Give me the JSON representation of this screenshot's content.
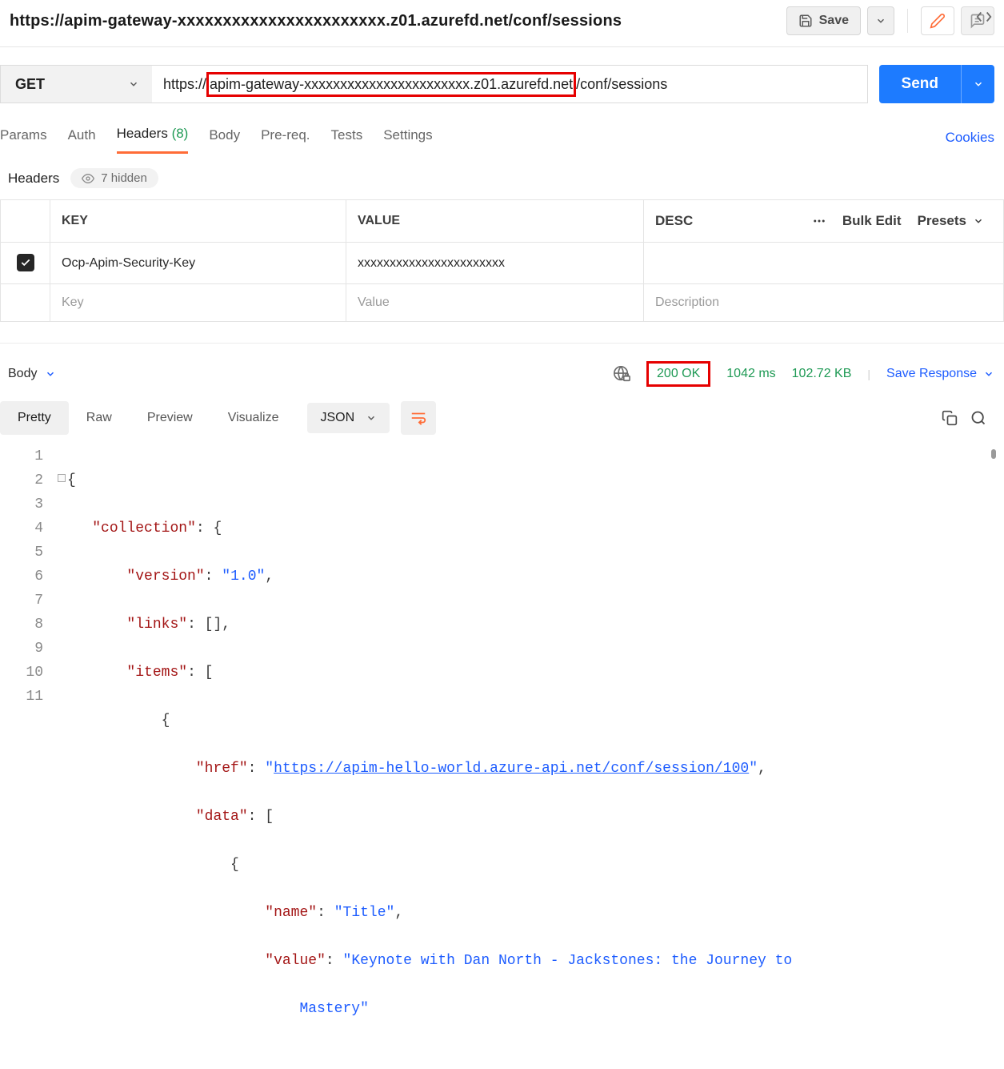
{
  "header": {
    "title": "https://apim-gateway-xxxxxxxxxxxxxxxxxxxxxxx.z01.azurefd.net/conf/sessions",
    "save_label": "Save"
  },
  "request": {
    "method": "GET",
    "url_prefix": "https://",
    "url_highlight": "apim-gateway-xxxxxxxxxxxxxxxxxxxxxxx.z01.azurefd.net",
    "url_suffix": "/conf/sessions",
    "send_label": "Send"
  },
  "tabs": {
    "params": "Params",
    "auth": "Auth",
    "headers": "Headers",
    "headers_count": "(8)",
    "body": "Body",
    "prereq": "Pre-req.",
    "tests": "Tests",
    "settings": "Settings",
    "cookies": "Cookies"
  },
  "headers_section": {
    "title": "Headers",
    "hidden_text": "7 hidden",
    "col_key": "KEY",
    "col_value": "VALUE",
    "col_desc": "DESC",
    "bulk_edit": "Bulk Edit",
    "presets": "Presets",
    "rows": [
      {
        "key": "Ocp-Apim-Security-Key",
        "value": "xxxxxxxxxxxxxxxxxxxxxxx"
      }
    ],
    "ph_key": "Key",
    "ph_value": "Value",
    "ph_desc": "Description"
  },
  "response": {
    "body_label": "Body",
    "status": "200 OK",
    "time": "1042 ms",
    "size": "102.72 KB",
    "save_response": "Save Response",
    "view_tabs": {
      "pretty": "Pretty",
      "raw": "Raw",
      "preview": "Preview",
      "visualize": "Visualize"
    },
    "format": "JSON"
  },
  "json_body": {
    "l2_key": "collection",
    "l3_key": "version",
    "l3_val": "1.0",
    "l4_key": "links",
    "l5_key": "items",
    "l7_key": "href",
    "l7_val": "https://apim-hello-world.azure-api.net/conf/session/100",
    "l8_key": "data",
    "l10_key": "name",
    "l10_val": "Title",
    "l11_key": "value",
    "l11_val": "Keynote with Dan North - Jackstones: the Journey to",
    "l11_cont": "Mastery"
  }
}
